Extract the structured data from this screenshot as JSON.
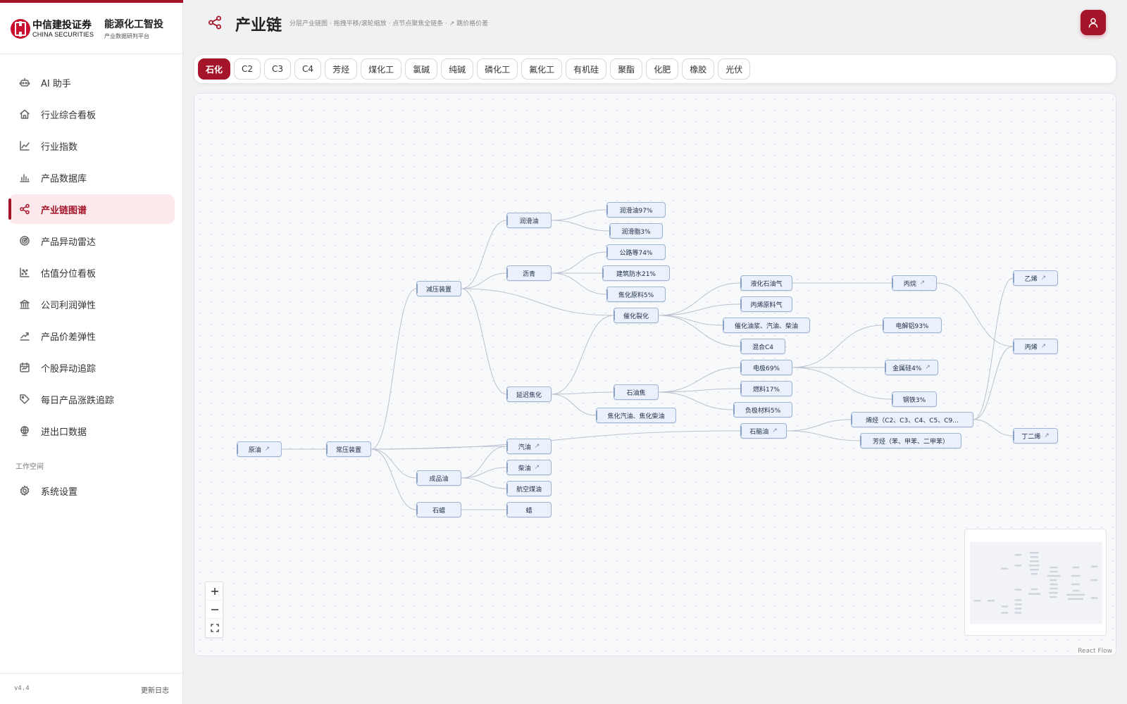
{
  "brand": {
    "logo_cn": "中信建投证券",
    "logo_en": "CHINA SECURITIES",
    "platform_name": "能源化工智投",
    "platform_sub": "产业数据研判平台"
  },
  "nav": [
    {
      "label": "AI 助手",
      "icon": "robot-icon",
      "active": false
    },
    {
      "label": "行业综合看板",
      "icon": "home-icon",
      "active": false
    },
    {
      "label": "行业指数",
      "icon": "line-chart-icon",
      "active": false
    },
    {
      "label": "产品数据库",
      "icon": "bar-chart-icon",
      "active": false
    },
    {
      "label": "产业链图谱",
      "icon": "share-icon",
      "active": true
    },
    {
      "label": "产品异动雷达",
      "icon": "radar-icon",
      "active": false
    },
    {
      "label": "估值分位看板",
      "icon": "scatter-icon",
      "active": false
    },
    {
      "label": "公司利润弹性",
      "icon": "bank-icon",
      "active": false
    },
    {
      "label": "产品价差弹性",
      "icon": "trend-icon",
      "active": false
    },
    {
      "label": "个股异动追踪",
      "icon": "calendar-icon",
      "active": false
    },
    {
      "label": "每日产品涨跌追踪",
      "icon": "tag-icon",
      "active": false
    },
    {
      "label": "进出口数据",
      "icon": "globe-icon",
      "active": false
    }
  ],
  "workspace": {
    "section_label": "工作空间",
    "settings_label": "系统设置"
  },
  "footer": {
    "version": "v4.4",
    "changelog": "更新日志"
  },
  "header": {
    "title": "产业链",
    "hint": "分层产业链图 · 拖拽平移/滚轮缩放 · 点节点聚焦全链条 · ↗ 跳价格价差"
  },
  "tabs": [
    "石化",
    "C2",
    "C3",
    "C4",
    "芳烃",
    "煤化工",
    "氯碱",
    "纯碱",
    "磷化工",
    "氟化工",
    "有机硅",
    "聚酯",
    "化肥",
    "橡胶",
    "光伏"
  ],
  "active_tab": "石化",
  "flow": {
    "attribution": "React Flow",
    "nodes": {
      "yuanyou": {
        "label": "原油",
        "link": true
      },
      "changya": {
        "label": "常压装置",
        "link": false
      },
      "jianya": {
        "label": "减压装置",
        "link": false
      },
      "chengpinyou": {
        "label": "成品油",
        "link": false
      },
      "shila": {
        "label": "石蜡",
        "link": false
      },
      "runhuayou": {
        "label": "润滑油",
        "link": false
      },
      "liqing": {
        "label": "沥青",
        "link": false
      },
      "yanchi": {
        "label": "延迟焦化",
        "link": false
      },
      "qiyou": {
        "label": "汽油",
        "link": true
      },
      "chaiyou": {
        "label": "柴油",
        "link": true
      },
      "hangkong": {
        "label": "航空煤油",
        "link": false
      },
      "la": {
        "label": "蜡",
        "link": false
      },
      "rh97": {
        "label": "润滑油97%",
        "link": false
      },
      "rhz3": {
        "label": "润滑脂3%",
        "link": false
      },
      "gl74": {
        "label": "公路等74%",
        "link": false
      },
      "jz21": {
        "label": "建筑防水21%",
        "link": false
      },
      "jh5": {
        "label": "焦化原料5%",
        "link": false
      },
      "cuihua": {
        "label": "催化裂化",
        "link": false
      },
      "shiyoujiao": {
        "label": "石油焦",
        "link": false
      },
      "jhqc": {
        "label": "焦化汽油、焦化柴油",
        "link": false
      },
      "yhsyq": {
        "label": "液化石油气",
        "link": false
      },
      "bxylq": {
        "label": "丙烯原料气",
        "link": false
      },
      "chyj": {
        "label": "催化油浆、汽油、柴油",
        "link": false
      },
      "hhc4": {
        "label": "混合C4",
        "link": false
      },
      "dianji": {
        "label": "电极69%",
        "link": false
      },
      "ranliao": {
        "label": "燃料17%",
        "link": false
      },
      "fuji": {
        "label": "负极材料5%",
        "link": false
      },
      "shinaoyou": {
        "label": "石脑油",
        "link": true
      },
      "bingwan": {
        "label": "丙烷",
        "link": true
      },
      "djl": {
        "label": "电解铝93%",
        "link": false
      },
      "jsg": {
        "label": "金属硅4%",
        "link": true
      },
      "gt3": {
        "label": "钢铁3%",
        "link": false
      },
      "xiting": {
        "label": "烯烃（C2、C3、C4、C5、C9...",
        "link": false
      },
      "fangting": {
        "label": "芳烃（苯、甲苯、二甲苯）",
        "link": false
      },
      "yixi": {
        "label": "乙烯",
        "link": true
      },
      "bingxi": {
        "label": "丙烯",
        "link": true
      },
      "dingerxi": {
        "label": "丁二烯",
        "link": true
      }
    }
  }
}
